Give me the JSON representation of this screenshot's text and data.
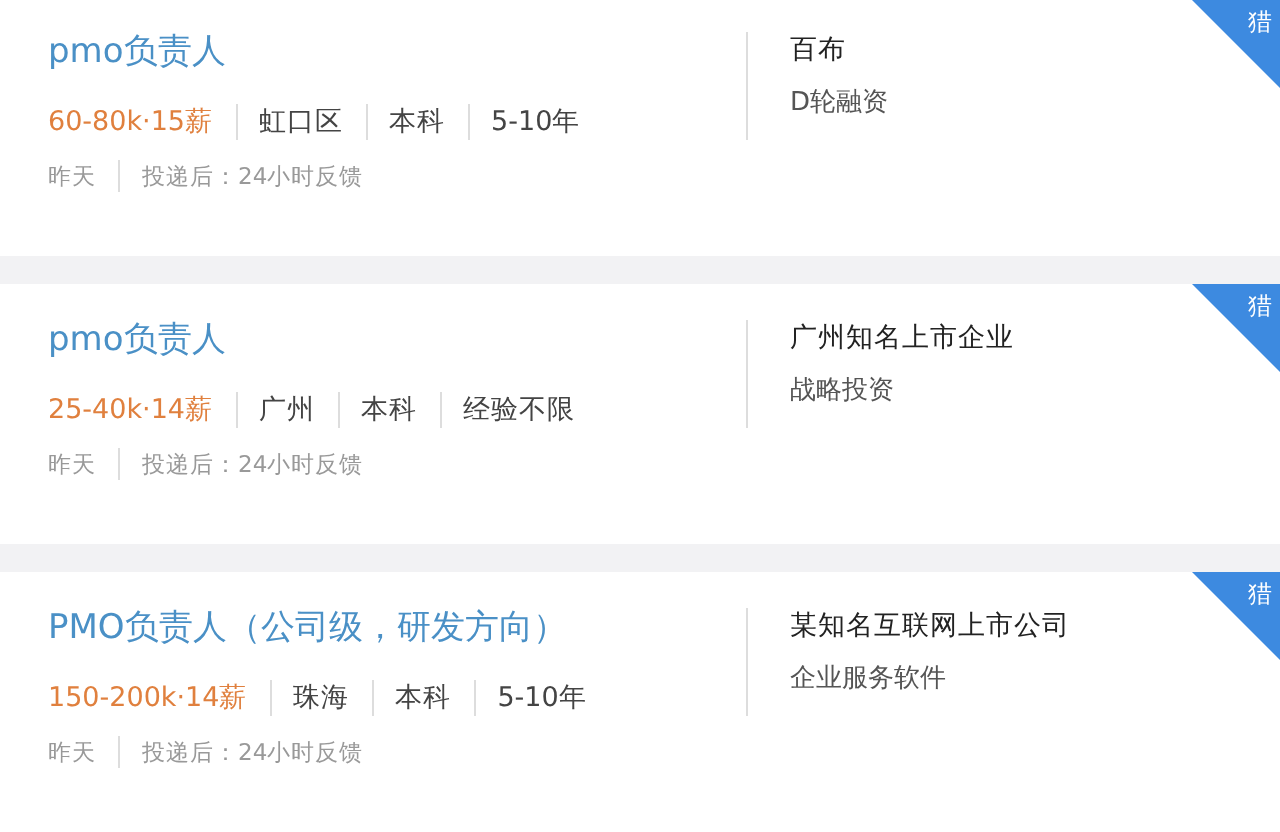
{
  "jobs": [
    {
      "title": "pmo负责人",
      "salary": "60-80k·15薪",
      "tags": [
        "虹口区",
        "本科",
        "5-10年"
      ],
      "posted": "昨天",
      "feedback": "投递后：24小时反馈",
      "company": "百布",
      "funding": "D轮融资",
      "badge": "猎"
    },
    {
      "title": "pmo负责人",
      "salary": "25-40k·14薪",
      "tags": [
        "广州",
        "本科",
        "经验不限"
      ],
      "posted": "昨天",
      "feedback": "投递后：24小时反馈",
      "company": "广州知名上市企业",
      "funding": "战略投资",
      "badge": "猎"
    },
    {
      "title": "PMO负责人（公司级，研发方向）",
      "salary": "150-200k·14薪",
      "tags": [
        "珠海",
        "本科",
        "5-10年"
      ],
      "posted": "昨天",
      "feedback": "投递后：24小时反馈",
      "company": "某知名互联网上市公司",
      "funding": "企业服务软件",
      "badge": "猎"
    }
  ]
}
